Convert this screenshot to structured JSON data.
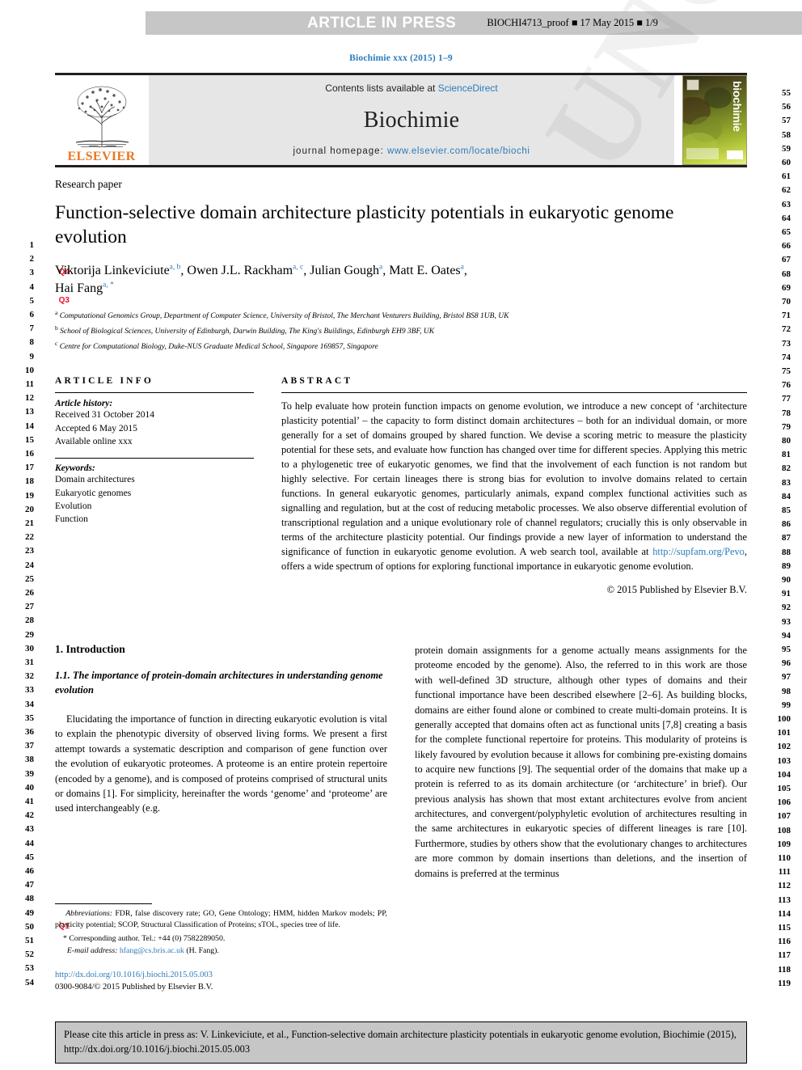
{
  "proof_banner": {
    "title": "ARTICLE IN PRESS",
    "meta": "BIOCHI4713_proof ■ 17 May 2015 ■ 1/9",
    "background_color": "#c6c6c6"
  },
  "watermark": {
    "text": "UNCORRECTED PROOF"
  },
  "line_numbers": {
    "left_start": 1,
    "left_end": 54,
    "right_start": 55,
    "right_end": 119,
    "query_markers": [
      {
        "label": "Q4",
        "at_line": 3
      },
      {
        "label": "Q3",
        "at_line": 5
      },
      {
        "label": "Q1",
        "at_line": 50
      }
    ],
    "marker_color": "#e8112d"
  },
  "journal_ref": "Biochimie xxx (2015) 1–9",
  "masthead": {
    "publisher": "ELSEVIER",
    "contents_prefix": "Contents lists available at ",
    "contents_link": "ScienceDirect",
    "journal_name": "Biochimie",
    "homepage_label": "journal homepage:",
    "homepage_url": "www.elsevier.com/locate/biochi",
    "cover_title": "biochimie",
    "link_color": "#2b7bba",
    "accent_color": "#e87722"
  },
  "article": {
    "type": "Research paper",
    "title": "Function-selective domain architecture plasticity potentials in eukaryotic genome evolution",
    "authors": [
      {
        "name": "Viktorija Linkeviciute",
        "marks": "a, b",
        "sep": ", "
      },
      {
        "name": "Owen J.L. Rackham",
        "marks": "a, c",
        "sep": ", "
      },
      {
        "name": "Julian Gough",
        "marks": "a",
        "sep": ", "
      },
      {
        "name": "Matt E. Oates",
        "marks": "a",
        "sep": ","
      },
      {
        "name": "Hai Fang",
        "marks": "a, *",
        "sep": ""
      }
    ],
    "affiliations": [
      {
        "mark": "a",
        "text": "Computational Genomics Group, Department of Computer Science, University of Bristol, The Merchant Venturers Building, Bristol BS8 1UB, UK"
      },
      {
        "mark": "b",
        "text": "School of Biological Sciences, University of Edinburgh, Darwin Building, The King's Buildings, Edinburgh EH9 3BF, UK"
      },
      {
        "mark": "c",
        "text": "Centre for Computational Biology, Duke-NUS Graduate Medical School, Singapore 169857, Singapore"
      }
    ]
  },
  "article_info": {
    "heading": "ARTICLE INFO",
    "history_label": "Article history:",
    "history": [
      "Received 31 October 2014",
      "Accepted 6 May 2015",
      "Available online xxx"
    ],
    "keywords_label": "Keywords:",
    "keywords": [
      "Domain architectures",
      "Eukaryotic genomes",
      "Evolution",
      "Function"
    ]
  },
  "abstract": {
    "heading": "ABSTRACT",
    "part1": "To help evaluate how protein function impacts on genome evolution, we introduce a new concept of ‘architecture plasticity potential’ – the capacity to form distinct domain architectures – both for an individual domain, or more generally for a set of domains grouped by shared function. We devise a scoring metric to measure the plasticity potential for these sets, and evaluate how function has changed over time for different species. Applying this metric to a phylogenetic tree of eukaryotic genomes, we find that the involvement of each function is not random but highly selective. For certain lineages there is strong bias for evolution to involve domains related to certain functions. In general eukaryotic genomes, particularly animals, expand complex functional activities such as signalling and regulation, but at the cost of reducing metabolic processes. We also observe differential evolution of transcriptional regulation and a unique evolutionary role of channel regulators; crucially this is only observable in terms of the architecture plasticity potential. Our findings provide a new layer of information to understand the significance of function in eukaryotic genome evolution. A web search tool, available at ",
    "link_text": "http://supfam.org/Pevo",
    "part2": ", offers a wide spectrum of options for exploring functional importance in eukaryotic genome evolution.",
    "copyright": "© 2015 Published by Elsevier B.V."
  },
  "body": {
    "section_heading": "1. Introduction",
    "subsection_heading": "1.1. The importance of protein-domain architectures in understanding genome evolution",
    "left_paragraph": "Elucidating the importance of function in directing eukaryotic evolution is vital to explain the phenotypic diversity of observed living forms. We present a first attempt towards a systematic description and comparison of gene function over the evolution of eukaryotic proteomes. A proteome is an entire protein repertoire (encoded by a genome), and is composed of proteins comprised of structural units or domains [1]. For simplicity, hereinafter the words ‘genome’ and ‘proteome’ are used interchangeably (e.g.",
    "right_paragraph": "protein domain assignments for a genome actually means assignments for the proteome encoded by the genome). Also, the referred to in this work are those with well-defined 3D structure, although other types of domains and their functional importance have been described elsewhere [2–6]. As building blocks, domains are either found alone or combined to create multi-domain proteins. It is generally accepted that domains often act as functional units [7,8] creating a basis for the complete functional repertoire for proteins. This modularity of proteins is likely favoured by evolution because it allows for combining pre-existing domains to acquire new functions [9]. The sequential order of the domains that make up a protein is referred to as its domain architecture (or ‘architecture’ in brief). Our previous analysis has shown that most extant architectures evolve from ancient architectures, and convergent/polyphyletic evolution of architectures resulting in the same architectures in eukaryotic species of different lineages is rare [10]. Furthermore, studies by others show that the evolutionary changes to architectures are more common by domain insertions than deletions, and the insertion of domains is preferred at the terminus"
  },
  "footnote": {
    "abbrev_label": "Abbreviations:",
    "abbrev_text": " FDR, false discovery rate; GO, Gene Ontology; HMM, hidden Markov models; PP, plasticity potential; SCOP, Structural Classification of Proteins; sTOL, species tree of life.",
    "corresponding": "* Corresponding author. Tel.: +44 (0) 7582289050.",
    "email_label": "E-mail address:",
    "email": "hfang@cs.bris.ac.uk",
    "email_suffix": " (H. Fang).",
    "doi": "http://dx.doi.org/10.1016/j.biochi.2015.05.003",
    "issn": "0300-9084/© 2015 Published by Elsevier B.V."
  },
  "cite_box": {
    "text": "Please cite this article in press as: V. Linkeviciute, et al., Function-selective domain architecture plasticity potentials in eukaryotic genome evolution, Biochimie (2015), http://dx.doi.org/10.1016/j.biochi.2015.05.003",
    "background_color": "#c6c6c6"
  }
}
